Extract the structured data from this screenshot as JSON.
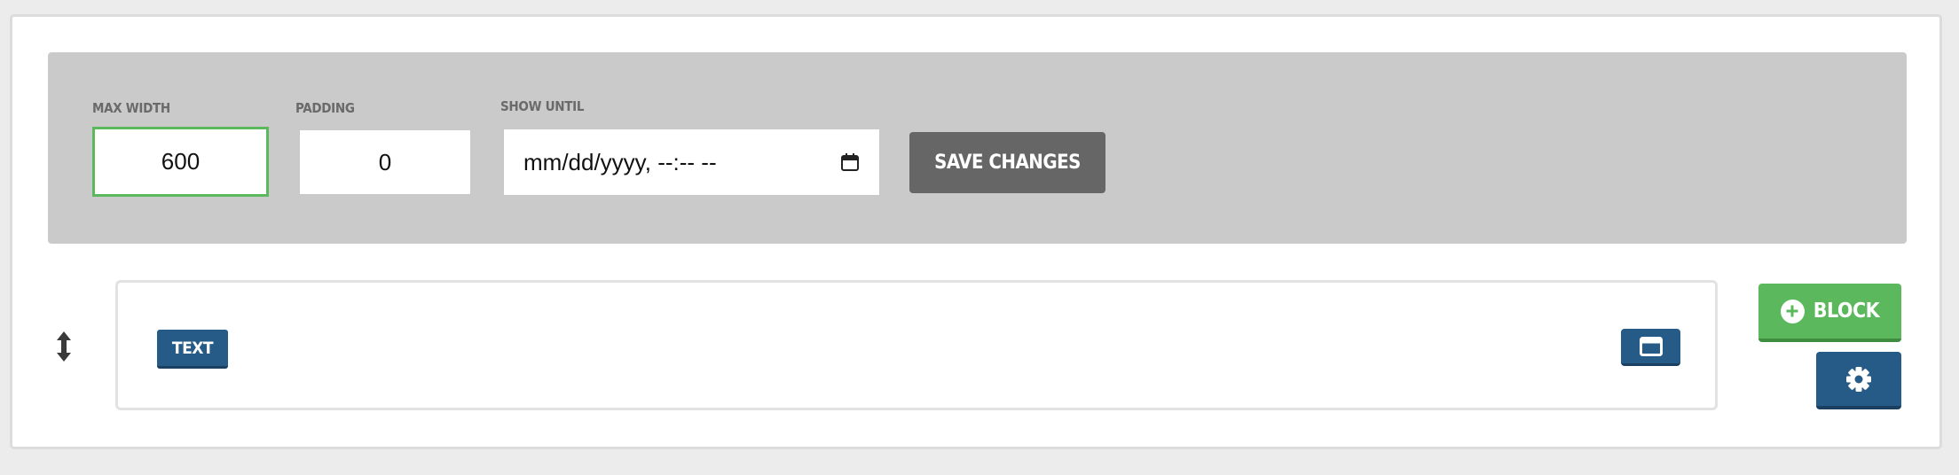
{
  "settings": {
    "max_width": {
      "label": "MAX WIDTH",
      "value": "600"
    },
    "padding": {
      "label": "PADDING",
      "value": "0"
    },
    "show_until": {
      "label": "SHOW UNTIL",
      "placeholder": "mm/dd/yyyy, --:-- --"
    },
    "save_label": "SAVE CHANGES"
  },
  "block": {
    "type_label": "TEXT"
  },
  "actions": {
    "add_block_label": "BLOCK"
  },
  "icons": {
    "drag": "vertical-arrows-icon",
    "calendar": "calendar-icon",
    "window": "window-icon",
    "add": "plus-circle-icon",
    "settings": "gear-icon"
  },
  "colors": {
    "accent_green": "#5cb85c",
    "primary_blue": "#265a87",
    "panel_gray": "#cacaca",
    "save_button_gray": "#666666"
  }
}
